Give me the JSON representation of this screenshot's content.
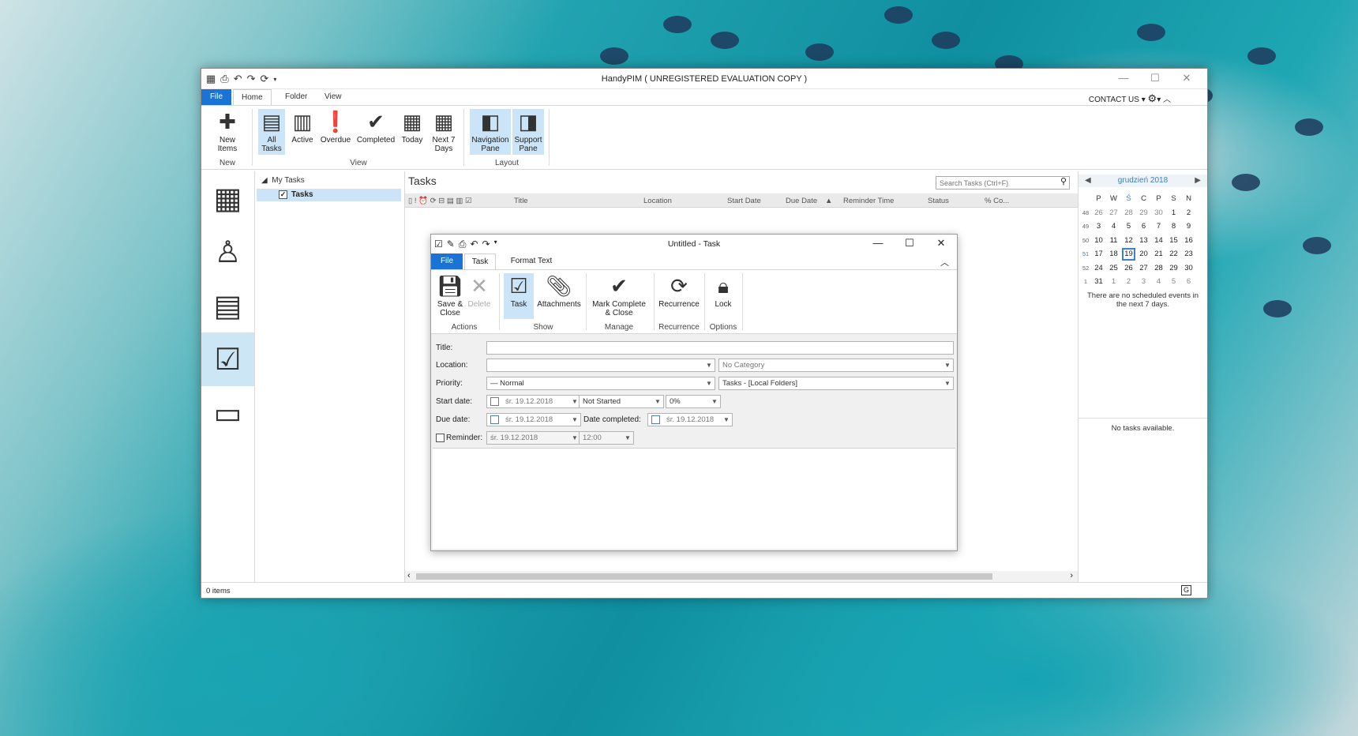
{
  "app": {
    "title": "HandyPIM ( UNREGISTERED EVALUATION COPY )",
    "contact": "CONTACT US",
    "tabs": [
      "File",
      "Home",
      "Folder",
      "View"
    ]
  },
  "ribbon": {
    "new_items": "New Items",
    "group_new": "New",
    "all_tasks": "All Tasks",
    "active": "Active",
    "overdue": "Overdue",
    "completed": "Completed",
    "today": "Today",
    "next7": "Next 7 Days",
    "group_view": "View",
    "nav_pane": "Navigation Pane",
    "support_pane": "Support Pane",
    "group_layout": "Layout"
  },
  "folders": {
    "root": "My Tasks",
    "tasks": "Tasks"
  },
  "main": {
    "title": "Tasks",
    "search_placeholder": "Search Tasks (Ctrl+F)",
    "columns": [
      "Title",
      "Location",
      "Start Date",
      "Due Date",
      "Reminder Time",
      "Status",
      "% Co..."
    ]
  },
  "calendar": {
    "month": "grudzień 2018",
    "days": [
      "P",
      "W",
      "Ś",
      "C",
      "P",
      "S",
      "N"
    ],
    "weeks": [
      {
        "wk": "48",
        "d": [
          "26",
          "27",
          "28",
          "29",
          "30",
          "1",
          "2"
        ]
      },
      {
        "wk": "49",
        "d": [
          "3",
          "4",
          "5",
          "6",
          "7",
          "8",
          "9"
        ]
      },
      {
        "wk": "50",
        "d": [
          "10",
          "11",
          "12",
          "13",
          "14",
          "15",
          "16"
        ]
      },
      {
        "wk": "51",
        "d": [
          "17",
          "18",
          "19",
          "20",
          "21",
          "22",
          "23"
        ]
      },
      {
        "wk": "52",
        "d": [
          "24",
          "25",
          "26",
          "27",
          "28",
          "29",
          "30"
        ]
      },
      {
        "wk": "1",
        "d": [
          "31",
          "1",
          "2",
          "3",
          "4",
          "5",
          "6"
        ]
      }
    ],
    "no_events": "There are no scheduled events in the next 7 days.",
    "no_tasks": "No tasks available."
  },
  "status": {
    "items": "0 items"
  },
  "dialog": {
    "title": "Untitled - Task",
    "tabs": [
      "File",
      "Task",
      "Format Text"
    ],
    "save_close": "Save & Close",
    "delete": "Delete",
    "group_actions": "Actions",
    "task": "Task",
    "attachments": "Attachments",
    "group_show": "Show",
    "mark_complete": "Mark Complete & Close",
    "group_manage": "Manage",
    "recurrence": "Recurrence",
    "group_recurrence": "Recurrence",
    "lock": "Lock",
    "group_options": "Options",
    "labels": {
      "title": "Title:",
      "location": "Location:",
      "priority": "Priority:",
      "start_date": "Start date:",
      "due_date": "Due date:",
      "reminder": "Reminder:",
      "date_completed": "Date completed:"
    },
    "values": {
      "category": "No Category",
      "priority": "— Normal",
      "folder": "Tasks - [Local Folders]",
      "start_date": "śr.     19.12.2018",
      "due_date": "śr.     19.12.2018",
      "completed_date": "śr.     19.12.2018",
      "reminder_date": "śr.     19.12.2018",
      "status": "Not Started",
      "percent": "0%",
      "reminder_time": "12:00"
    }
  }
}
